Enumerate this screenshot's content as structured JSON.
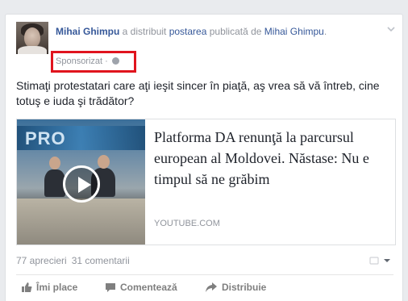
{
  "post": {
    "author": "Mihai Ghimpu",
    "action_text": " a distribuit ",
    "link_postarea": "postarea",
    "mid_text": " publicată de ",
    "original_author": "Mihai Ghimpu",
    "end_punct": ".",
    "sponsored_label": "Sponsorizat",
    "separator": " · ",
    "body": "Stimaţi protestatari care aţi ieşit sincer în piaţă, aş vrea să vă întreb, cine totuş e iuda şi trădător?"
  },
  "link_preview": {
    "title": "Platforma DA renunţă la parcursul european al Moldovei. Năstase: Nu e timpul să ne grăbim",
    "domain": "YOUTUBE.COM",
    "thumb_logo": "PRO"
  },
  "stats": {
    "likes": "77 aprecieri",
    "comments": "31 comentarii"
  },
  "actions": {
    "like": "Îmi place",
    "comment": "Comentează",
    "share": "Distribuie"
  },
  "colors": {
    "link": "#365899",
    "meta": "#90949c",
    "highlight": "#e0141e"
  }
}
